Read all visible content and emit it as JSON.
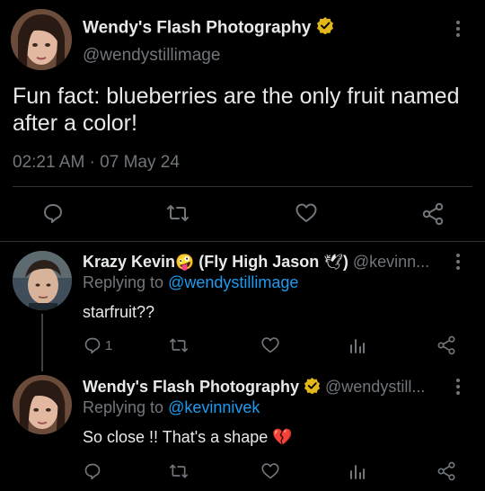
{
  "colors": {
    "background": "#000000",
    "text": "#e7e9ea",
    "muted": "#71767b",
    "link": "#1d9bf0",
    "verified_gold": "#e2b719",
    "divider": "#2f3336"
  },
  "main_tweet": {
    "display_name": "Wendy's Flash Photography",
    "handle": "@wendystillimage",
    "verified": true,
    "text": "Fun fact: blueberries are the only fruit named after a color!",
    "timestamp": "02:21 AM · 07 May 24",
    "actions": [
      "reply-icon",
      "retweet-icon",
      "like-icon",
      "share-icon"
    ]
  },
  "replies": [
    {
      "display_name_pre": "Krazy Kevin",
      "emoji_1": "🤪",
      "display_name_mid": " (Fly High Jason ",
      "emoji_2": "🕊",
      "display_name_post": ")",
      "handle": "@kevinn...",
      "replying_to_label": "Replying to",
      "replying_to": "@wendystillimage",
      "text": "starfruit??",
      "reply_count": "1",
      "actions": [
        "reply-icon",
        "retweet-icon",
        "like-icon",
        "stats-icon",
        "share-icon"
      ]
    },
    {
      "display_name": "Wendy's Flash Photography",
      "verified": true,
      "handle": "@wendystill...",
      "replying_to_label": "Replying to",
      "replying_to": "@kevinnivek",
      "text": "So close !! That's a shape",
      "emoji": "💔",
      "actions": [
        "reply-icon",
        "retweet-icon",
        "like-icon",
        "stats-icon",
        "share-icon"
      ]
    }
  ]
}
